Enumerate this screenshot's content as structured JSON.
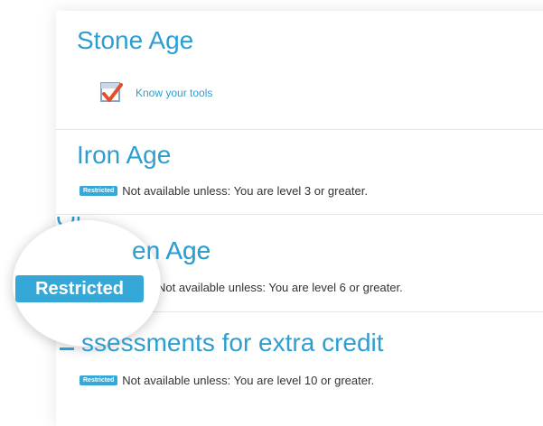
{
  "sections": [
    {
      "title": "Stone Age"
    },
    {
      "title": "Iron Age",
      "restricted_badge": "Restricted",
      "condition": "Not available unless: You are level 3 or greater."
    },
    {
      "title": "en Age",
      "condition": "Not available unless: You are level 6 or greater."
    },
    {
      "title": "ssessments for extra credit",
      "restricted_badge": "Restricted",
      "condition": "Not available unless: You are level 10 or greater."
    }
  ],
  "activity": {
    "label": "Know your tools",
    "icon": "checkbox-check-icon"
  },
  "magnifier": {
    "badge": "Restricted",
    "fragment_above": "Ol"
  },
  "colors": {
    "link": "#2d9ed1",
    "badge": "#35a8d8",
    "text": "#333333"
  }
}
